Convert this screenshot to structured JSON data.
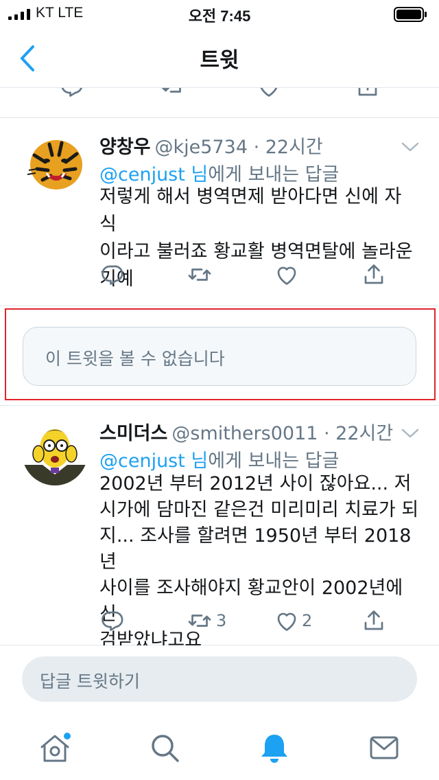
{
  "status_bar": {
    "carrier": "KT  LTE",
    "time": "오전 7:45"
  },
  "header": {
    "title": "트윗"
  },
  "tweets": [
    {
      "author": "양창우",
      "handle_time": "@kje5734 · 22시간",
      "reply_to_user": "@cenjust 님",
      "reply_to_rest": "에게 보내는 답글",
      "text": "저렇게 해서 병역면제 받아다면 신에 자식\n이라고 불러죠 황교활 병역면탈에 놀라운\n기예",
      "retweets": "",
      "likes": ""
    },
    {
      "author": "스미더스",
      "handle_time": "@smithers0011 · 22시간",
      "reply_to_user": "@cenjust 님",
      "reply_to_rest": "에게 보내는 답글",
      "text": "2002년 부터 2012년 사이 잖아요... 저\n시가에 담마진 같은건 미리미리 치료가 되\n지... 조사를 할려면 1950년 부터 2018년\n사이를 조사해야지 황교안이 2002년에 신\n검받았냐고요",
      "retweets": "3",
      "likes": "2"
    }
  ],
  "unavailable": {
    "text": "이 트윗을 볼 수 없습니다"
  },
  "reply_bar": {
    "placeholder": "답글 트윗하기"
  },
  "tabs": [
    "home-icon",
    "search-icon",
    "notifications-icon",
    "messages-icon"
  ],
  "colors": {
    "accent": "#1da1f2",
    "secondary_text": "#657786",
    "highlight_border": "#e0242b"
  }
}
